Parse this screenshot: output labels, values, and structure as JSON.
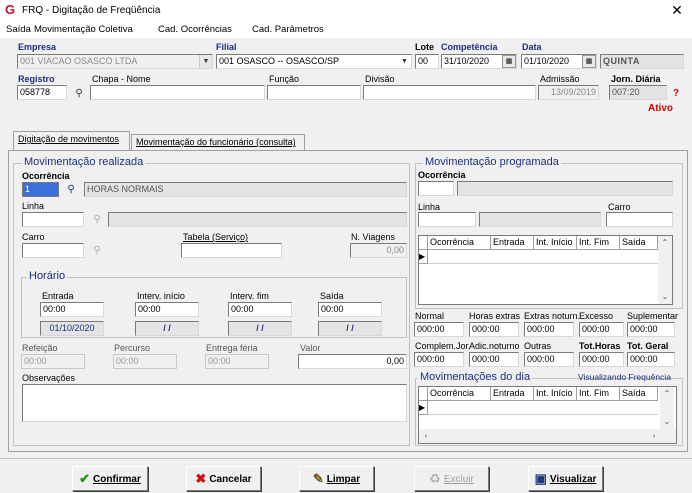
{
  "window": {
    "title": "FRQ - Digitação de Freqüência",
    "close": "✕"
  },
  "menu": [
    "Saída",
    "Movimentação Coletiva",
    "Cad. Ocorrências",
    "Cad. Parâmetros"
  ],
  "header": {
    "empresa_label": "Empresa",
    "empresa_value": "001 VIACAO OSASCO LTDA",
    "filial_label": "Filial",
    "filial_value": "001 OSASCO -- OSASCO/SP",
    "lote_label": "Lote",
    "lote_value": "00",
    "competencia_label": "Competência",
    "competencia_value": "31/10/2020",
    "data_label": "Data",
    "data_value": "01/10/2020",
    "weekday": "QUINTA",
    "registro_label": "Registro",
    "registro_value": "058778",
    "chapa_label": "Chapa - Nome",
    "chapa_value": "",
    "funcao_label": "Função",
    "funcao_value": "",
    "divisao_label": "Divisão",
    "divisao_value": "",
    "admissao_label": "Admissão",
    "admissao_value": "13/09/2019",
    "jornada_label": "Jorn. Diária",
    "jornada_value": "007:20",
    "help": "?",
    "status": "Ativo"
  },
  "tabs": [
    "Digitação de movimentos",
    "Movimentação do funcionário (consulta)"
  ],
  "realizada": {
    "title": "Movimentação realizada",
    "ocorrencia_label": "Ocorrência",
    "ocorrencia_code": "1",
    "ocorrencia_desc": "HORAS NORMAIS",
    "linha_label": "Linha",
    "carro_label": "Carro",
    "tabela_label": "Tabela (Serviço)",
    "viagens_label": "N. Viagens",
    "viagens_value": "0,00",
    "horario_title": "Horário",
    "entrada_label": "Entrada",
    "entrada_value": "00:00",
    "entrada_date": "01/10/2020",
    "int_ini_label": "Interv. início",
    "int_ini_value": "00:00",
    "int_ini_date": " / /",
    "int_fim_label": "Interv. fim",
    "int_fim_value": "00:00",
    "int_fim_date": " / /",
    "saida_label": "Saída",
    "saida_value": "00:00",
    "saida_date": " / /",
    "refeicao_label": "Refeição",
    "refeicao_value": "00:00",
    "percurso_label": "Percurso",
    "percurso_value": "00:00",
    "ferias_label": "Entrega féria",
    "ferias_value": "00:00",
    "valor_label": "Valor",
    "valor_value": "0,00",
    "obs_label": "Observações"
  },
  "programada": {
    "title": "Movimentação programada",
    "ocorrencia_label": "Ocorrência",
    "linha_label": "Linha",
    "carro_label": "Carro",
    "grid_headers": [
      "Ocorrência",
      "Entrada",
      "Int. Início",
      "Int. Fim",
      "Saída"
    ]
  },
  "totais": {
    "labels_row1": [
      "Normal",
      "Horas extras",
      "Extras noturn.",
      "Excesso",
      "Suplementar"
    ],
    "values_row1": [
      "000:00",
      "000:00",
      "000:00",
      "000:00",
      "000:00"
    ],
    "labels_row2": [
      "Complem.Jor.",
      "Adic.noturno",
      "Outras",
      "Tot.Horas",
      "Tot. Geral"
    ],
    "values_row2": [
      "000:00",
      "000:00",
      "000:00",
      "000:00",
      "000:00"
    ]
  },
  "dia": {
    "title": "Movimentações do dia",
    "link": "Visualizando Frequência",
    "grid_headers": [
      "Ocorrência",
      "Entrada",
      "Int. Início",
      "Int. Fim",
      "Saída"
    ]
  },
  "buttons": {
    "confirmar": "Confirmar",
    "cancelar": "Cancelar",
    "limpar": "Limpar",
    "excluir": "Excluir",
    "visualizar": "Visualizar"
  }
}
